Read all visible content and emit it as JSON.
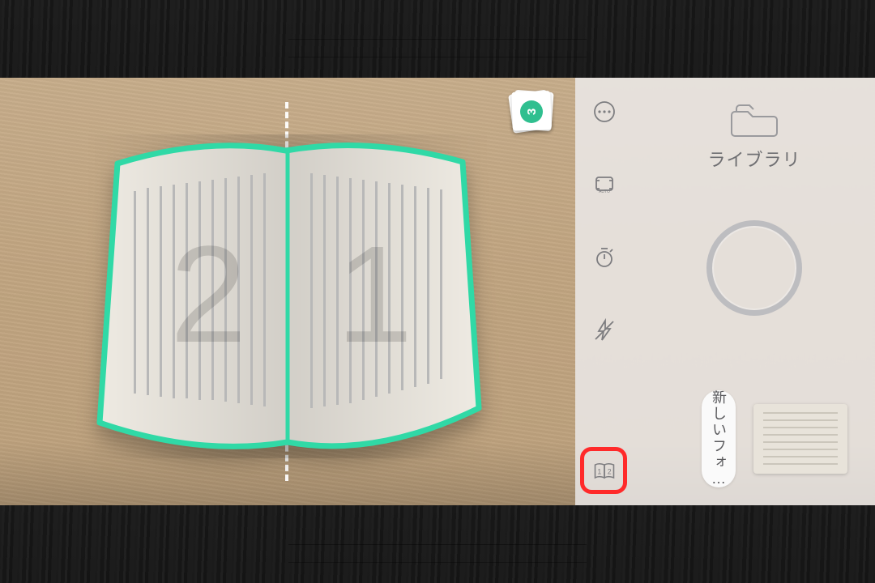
{
  "capture": {
    "left_page_overlay_number": "2",
    "right_page_overlay_number": "1",
    "scanned_count": "3"
  },
  "rail": {
    "more_name": "more-icon",
    "auto_name": "auto-crop-icon",
    "timer_name": "timer-icon",
    "flash_name": "flash-off-icon",
    "twopage_name": "two-page-mode-icon",
    "twopage_left_digit": "1",
    "twopage_right_digit": "2"
  },
  "right": {
    "library_label": "ライブラリ",
    "new_folder_label": "新しいフォ…"
  }
}
